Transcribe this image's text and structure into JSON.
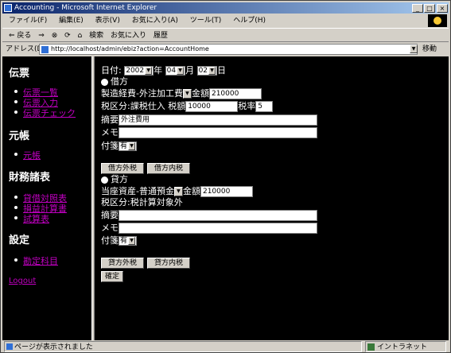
{
  "window": {
    "title": "Accounting - Microsoft Internet Explorer",
    "minimize": "_",
    "maximize": "□",
    "close": "×"
  },
  "menubar": {
    "items": [
      "ファイル(F)",
      "編集(E)",
      "表示(V)",
      "お気に入り(A)",
      "ツール(T)",
      "ヘルプ(H)"
    ]
  },
  "toolbar": {
    "back": "⇐ 戻る",
    "forward": "⇒",
    "stop": "⊗",
    "refresh": "⟳",
    "home": "⌂",
    "search": "検索",
    "favorites": "お気に入り",
    "history": "履歴"
  },
  "addressbar": {
    "label": "アドレス(D)",
    "url": "http://localhost/admin/ebiz?action=AccountHome",
    "go": "移動"
  },
  "sidebar": {
    "sections": [
      {
        "heading": "伝票",
        "items": [
          "伝票一覧",
          "伝票入力",
          "伝票チェック"
        ]
      },
      {
        "heading": "元帳",
        "items": [
          "元帳"
        ]
      },
      {
        "heading": "財務諸表",
        "items": [
          "貸借対照表",
          "損益計算書",
          "試算表"
        ]
      },
      {
        "heading": "設定",
        "items": [
          "勘定科目"
        ]
      }
    ],
    "logout": "Logout"
  },
  "form": {
    "date_label": "日付:",
    "year_value": "2002",
    "year_suffix": "年",
    "month_value": "04",
    "month_suffix": "月",
    "day_value": "02",
    "day_suffix": "日",
    "debit": {
      "heading": "借方",
      "account": "製造経費-外注加工費",
      "amount_label": "金額",
      "amount_value": "210000",
      "tax_label": "税区分:課税仕入 税額",
      "tax_value": "10000",
      "rate_label": "税率",
      "rate_value": "5",
      "summary_label": "摘要",
      "summary_value": "外注費用",
      "memo_label": "メモ",
      "memo_value": "",
      "voucher_label": "付箋",
      "voucher_value": "有",
      "btn_excl": "借方外税",
      "btn_incl": "借方内税"
    },
    "credit": {
      "heading": "貸方",
      "account": "当座資産-普通預金",
      "amount_label": "金額",
      "amount_value": "210000",
      "tax_label": "税区分:税計算対象外",
      "summary_label": "摘要",
      "summary_value": "",
      "memo_label": "メモ",
      "memo_value": "",
      "voucher_label": "付箋",
      "voucher_value": "有",
      "btn_excl": "貸方外税",
      "btn_incl": "貸方内税"
    },
    "confirm": "確定"
  },
  "status": {
    "message": "ページが表示されました",
    "zone": "イントラネット"
  }
}
